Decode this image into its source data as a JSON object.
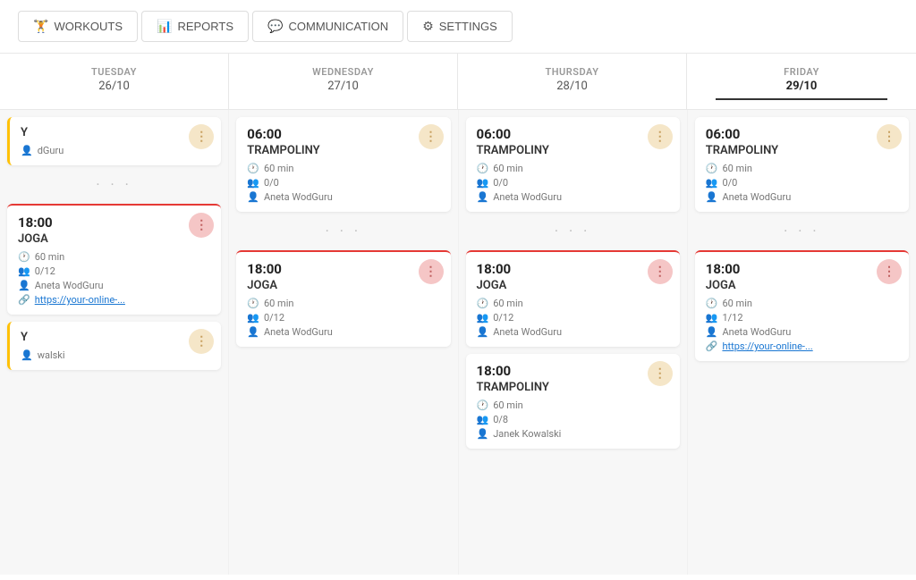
{
  "nav": {
    "tabs": [
      {
        "id": "workouts",
        "label": "WORKOUTS",
        "icon": "🏋"
      },
      {
        "id": "reports",
        "label": "REPORTS",
        "icon": "📊"
      },
      {
        "id": "communication",
        "label": "COMMUNICATION",
        "icon": "💬"
      },
      {
        "id": "settings",
        "label": "SETTINGS",
        "icon": "⚙"
      }
    ]
  },
  "calendar": {
    "days": [
      {
        "name": "TUESDAY",
        "date": "26/10",
        "active": false
      },
      {
        "name": "WEDNESDAY",
        "date": "27/10",
        "active": false
      },
      {
        "name": "THURSDAY",
        "date": "28/10",
        "active": false
      },
      {
        "name": "FRIDAY",
        "date": "29/10",
        "active": true
      }
    ],
    "columns": [
      {
        "day": "tuesday",
        "topCard": {
          "time": "",
          "title": "Y",
          "duration": "",
          "spots": "",
          "trainer": "dGuru",
          "border": "green",
          "partial": true,
          "showMenu": true,
          "menuStyle": "yellow"
        },
        "bottomCards": [
          {
            "time": "18:00",
            "title": "JOGA",
            "duration": "60 min",
            "spots": "0/12",
            "trainer": "Aneta WodGuru",
            "link": "https://your-online-...",
            "border": "red",
            "showMenu": true,
            "menuStyle": "pink"
          },
          {
            "time": "",
            "title": "Y",
            "duration": "",
            "spots": "",
            "trainer": "walski",
            "border": "yellow",
            "partial": true,
            "showMenu": true,
            "menuStyle": "yellow"
          }
        ]
      },
      {
        "day": "wednesday",
        "topCard": {
          "time": "06:00",
          "title": "TRAMPOLINY",
          "duration": "60 min",
          "spots": "0/0",
          "trainer": "Aneta WodGuru",
          "border": "none",
          "showMenu": true,
          "menuStyle": "yellow"
        },
        "bottomCards": [
          {
            "time": "18:00",
            "title": "JOGA",
            "duration": "60 min",
            "spots": "0/12",
            "trainer": "Aneta WodGuru",
            "link": null,
            "border": "red",
            "showMenu": true,
            "menuStyle": "pink"
          }
        ]
      },
      {
        "day": "thursday",
        "topCard": {
          "time": "06:00",
          "title": "TRAMPOLINY",
          "duration": "60 min",
          "spots": "0/0",
          "trainer": "Aneta WodGuru",
          "border": "none",
          "showMenu": true,
          "menuStyle": "yellow"
        },
        "bottomCards": [
          {
            "time": "18:00",
            "title": "JOGA",
            "duration": "60 min",
            "spots": "0/12",
            "trainer": "Aneta WodGuru",
            "link": null,
            "border": "red",
            "showMenu": true,
            "menuStyle": "pink"
          },
          {
            "time": "18:00",
            "title": "TRAMPOLINY",
            "duration": "60 min",
            "spots": "0/8",
            "trainer": "Janek Kowalski",
            "link": null,
            "border": "none",
            "showMenu": true,
            "menuStyle": "yellow"
          }
        ]
      },
      {
        "day": "friday",
        "topCard": {
          "time": "06:00",
          "title": "TRAMPOLINY",
          "duration": "60 min",
          "spots": "0/0",
          "trainer": "Aneta WodGuru",
          "border": "none",
          "showMenu": true,
          "menuStyle": "yellow"
        },
        "bottomCards": [
          {
            "time": "18:00",
            "title": "JOGA",
            "duration": "60 min",
            "spots": "1/12",
            "trainer": "Aneta WodGuru",
            "link": "https://your-online-...",
            "border": "red",
            "showMenu": true,
            "menuStyle": "pink"
          }
        ]
      }
    ]
  },
  "icons": {
    "clock": "🕐",
    "people": "👥",
    "person": "👤",
    "link": "🔗",
    "dots": "⋮"
  }
}
